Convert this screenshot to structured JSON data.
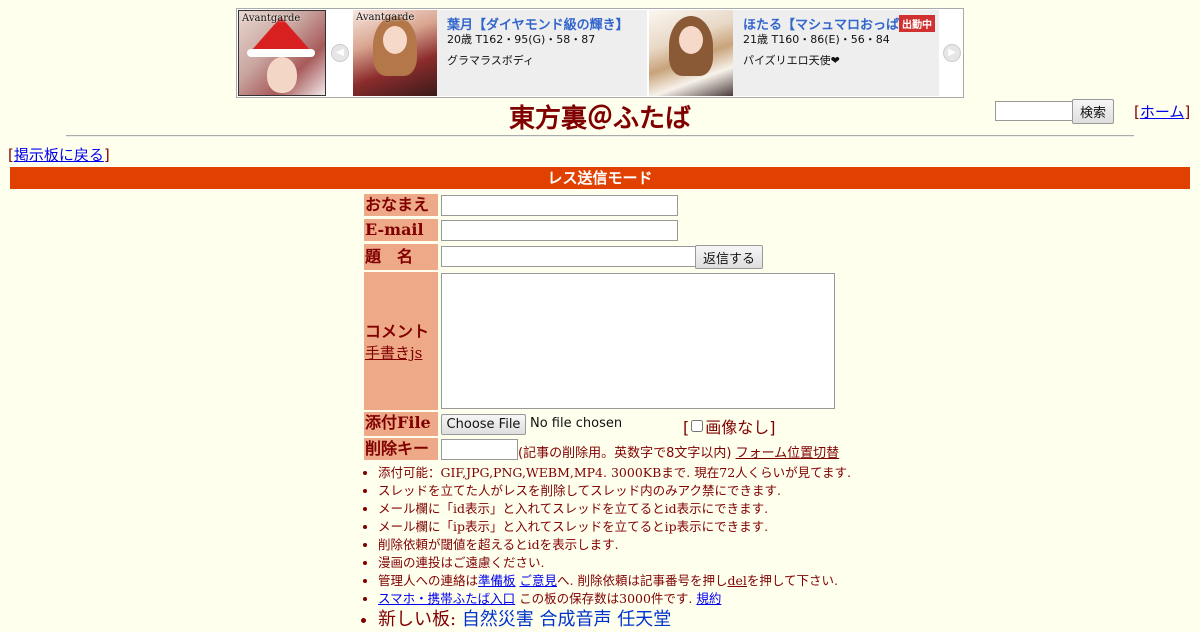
{
  "ad": {
    "main_logo": "Avantgarde",
    "slot1": {
      "logo": "Avantgarde",
      "name": "葉月【ダイヤモンド級の輝き】",
      "spec": "20歳 T162・95(G)・58・87",
      "desc": "グラマラスボディ"
    },
    "slot2": {
      "name": "ほたる【マシュマロおっぱ",
      "badge": "出勤中",
      "spec": "21歳 T160・86(E)・56・84",
      "desc": "パイズリエロ天使❤"
    },
    "prev_icon": "◀",
    "next_icon": "▶"
  },
  "header": {
    "title": "東方裏＠ふたば",
    "search_button": "検索",
    "home_open": "[",
    "home_label": "ホーム",
    "home_close": "]"
  },
  "nav": {
    "back_open": "[",
    "back_label": "掲示板に戻る",
    "back_close": "]"
  },
  "mode_label": "レス送信モード",
  "form": {
    "name_label": "おなまえ",
    "email_label": "E-mail",
    "subject_label": "題　名",
    "submit_label": "返信する",
    "comment_label": "コメント",
    "handwrite_link": "手書きjs",
    "file_label": "添付File",
    "file_button": "Choose File",
    "file_status": "No file chosen",
    "noimage_open": "[",
    "noimage_label": "画像なし",
    "noimage_close": "]",
    "delkey_label": "削除キー",
    "delkey_note": "(記事の削除用。英数字で8文字以内)",
    "form_toggle": "フォーム位置切替"
  },
  "rules": {
    "r1": "添付可能：GIF,JPG,PNG,WEBM,MP4. 3000KBまで. 現在72人くらいが見てます.",
    "r2": "スレッドを立てた人がレスを削除してスレッド内のみアク禁にできます.",
    "r3": "メール欄に「id表示」と入れてスレッドを立てるとid表示にできます.",
    "r4": "メール欄に「ip表示」と入れてスレッドを立てるとip表示にできます.",
    "r5": "削除依頼が閾値を超えるとidを表示します.",
    "r6": "漫画の連投はご遠慮ください.",
    "r7_a": "管理人への連絡は",
    "r7_link1": "準備板",
    "r7_link2": "ご意見",
    "r7_b": "へ. 削除依頼は記事番号を押し",
    "r7_link3": "del",
    "r7_c": "を押して下さい.",
    "r8_link1": "スマホ・携帯ふたば入口",
    "r8_a": "この板の保存数は3000件です.",
    "r8_link2": "規約",
    "r9_a": "新しい板:",
    "r9_link1": "自然災害",
    "r9_link2": "合成音声",
    "r9_link3": "任天堂"
  }
}
